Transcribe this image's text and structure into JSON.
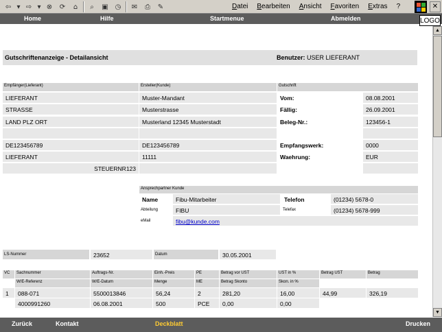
{
  "browser": {
    "menu": [
      "Datei",
      "Bearbeiten",
      "Ansicht",
      "Favoriten",
      "Extras",
      "?"
    ],
    "tools": [
      "back-icon",
      "forward-icon",
      "stop-icon",
      "refresh-icon",
      "home-icon",
      "search-icon",
      "favorites-icon",
      "history-icon",
      "mail-icon",
      "print-icon",
      "edit-icon"
    ]
  },
  "topnav": {
    "home": "Home",
    "hilfe": "Hilfe",
    "startmenue": "Startmenue",
    "abmelden": "Abmelden"
  },
  "logo": "LOGO",
  "title": {
    "text": "Gutschriftenanzeige - Detailansicht",
    "user_label": "Benutzer:",
    "user_value": "USER LIEFERANT"
  },
  "recipient": {
    "header": "Empfänger(Lieferant)",
    "lines": [
      "LIEFERANT",
      "STRASSE",
      "LAND PLZ  ORT",
      "",
      "DE123456789",
      "LIEFERANT",
      "STEUERNR123"
    ]
  },
  "creator": {
    "header": "Ersteller(Kunde)",
    "lines": [
      "Muster-Mandant",
      "Musterstrasse",
      "Musterland 12345  Musterstadt",
      "",
      "DE123456789",
      "11111",
      ""
    ]
  },
  "credit": {
    "header": "Gutschrift",
    "rows": [
      {
        "label": "Vom:",
        "value": "08.08.2001"
      },
      {
        "label": "Fällig:",
        "value": "26.09.2001"
      },
      {
        "label": "Beleg-Nr.:",
        "value": "123456-1"
      },
      {
        "label": "",
        "value": ""
      },
      {
        "label": "Empfangswerk:",
        "value": "0000"
      },
      {
        "label": "Waehrung:",
        "value": "EUR"
      },
      {
        "label": "",
        "value": ""
      }
    ]
  },
  "contact": {
    "header": "Ansprechpartner Kunde",
    "name_label": "Name",
    "name_value": "Fibu-Mitarbeiter",
    "dept_label": "Abteilung",
    "dept_value": "FIBU",
    "email_label": "eMail",
    "email_value": "fibu@kunde.com",
    "phone_label": "Telefon",
    "phone_value": "(01234) 5678-0",
    "fax_label": "Telefax",
    "fax_value": "(01234) 5678-999"
  },
  "ls": {
    "nr_label": "LS-Nummer",
    "nr_value": "23652",
    "date_label": "Datum",
    "date_value": "30.05.2001"
  },
  "items": {
    "header1": [
      "VC",
      "Sachnummer",
      "Auftrags-Nr.",
      "Einh.-Preis",
      "PE",
      "Betrag vor UST",
      "UST in %",
      "Betrag UST",
      "Betrag"
    ],
    "header2": [
      "W/E-Referenz",
      "W/E-Datum",
      "Menge",
      "ME",
      "Betrag Skonto",
      "Skon. in %"
    ],
    "row1": [
      "1",
      "088-071",
      "5500013846",
      "56,24",
      "2",
      "281,20",
      "16,00",
      "44,99",
      "326,19"
    ],
    "row2": [
      "4000991260",
      "06.08.2001",
      "500",
      "PCE",
      "0,00",
      "0,00"
    ]
  },
  "botnav": {
    "zurueck": "Zurück",
    "kontakt": "Kontakt",
    "deckblatt": "Deckblatt",
    "drucken": "Drucken"
  }
}
